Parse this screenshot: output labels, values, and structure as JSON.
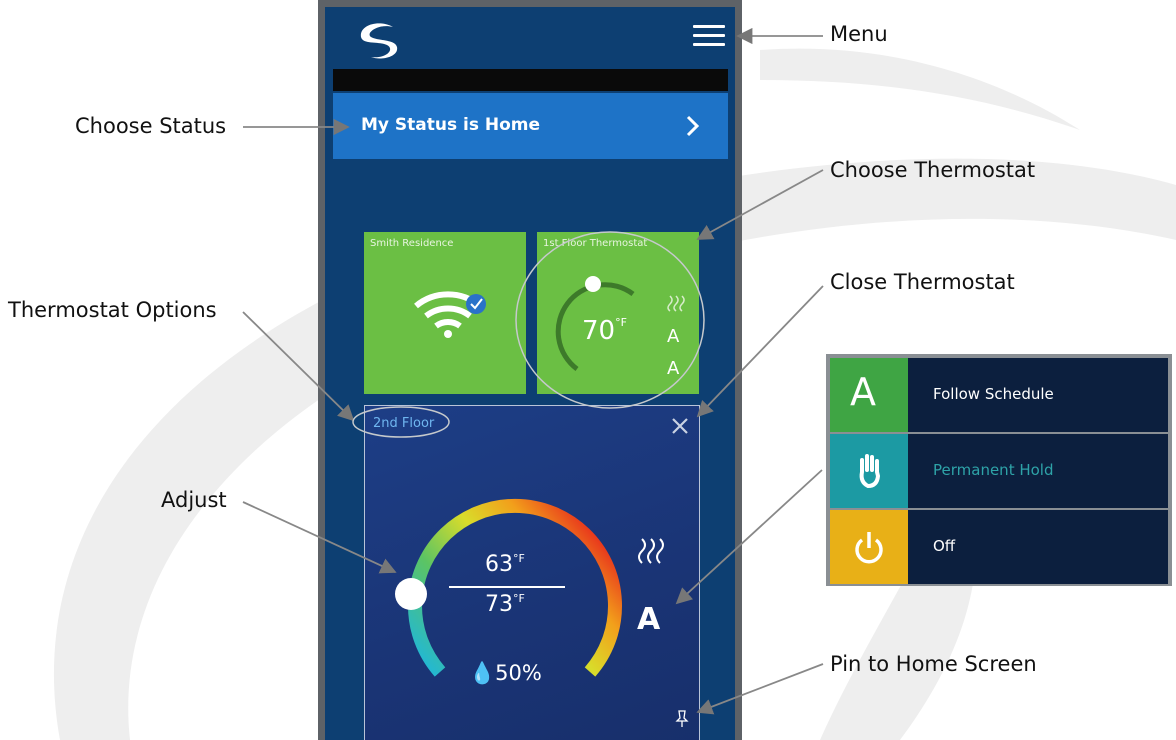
{
  "callouts": {
    "menu": "Menu",
    "choose_status": "Choose Status",
    "choose_thermostat": "Choose Thermostat",
    "close_thermostat": "Close Thermostat",
    "thermostat_options": "Thermostat Options",
    "adjust": "Adjust",
    "pin": "Pin to Home Screen"
  },
  "status": {
    "label": "My Status is Home"
  },
  "tiles": [
    {
      "title": "Smith Residence",
      "icon": "wifi-icon"
    },
    {
      "title": "1st Floor Thermostat",
      "temp": "70",
      "unit": "°F",
      "icons": [
        "heat-icon",
        "schedule-icon",
        "auto-icon"
      ]
    }
  ],
  "panel": {
    "name": "2nd Floor",
    "setpoint_heat": "63",
    "setpoint_cool": "73",
    "unit": "°F",
    "humidity": "50%",
    "mode_icons": [
      "heat-icon",
      "schedule-icon"
    ]
  },
  "options": [
    {
      "label": "Follow Schedule",
      "icon": "schedule-icon",
      "color": "#3fa544"
    },
    {
      "label": "Permanent Hold",
      "icon": "hand-icon",
      "color": "#1c9aa3"
    },
    {
      "label": "Off",
      "icon": "power-icon",
      "color": "#e8b017"
    }
  ],
  "colors": {
    "screen": "#0d3f72",
    "status_bar": "#1e73c7",
    "tile": "#6bbf44",
    "panel": "#1a3475"
  }
}
